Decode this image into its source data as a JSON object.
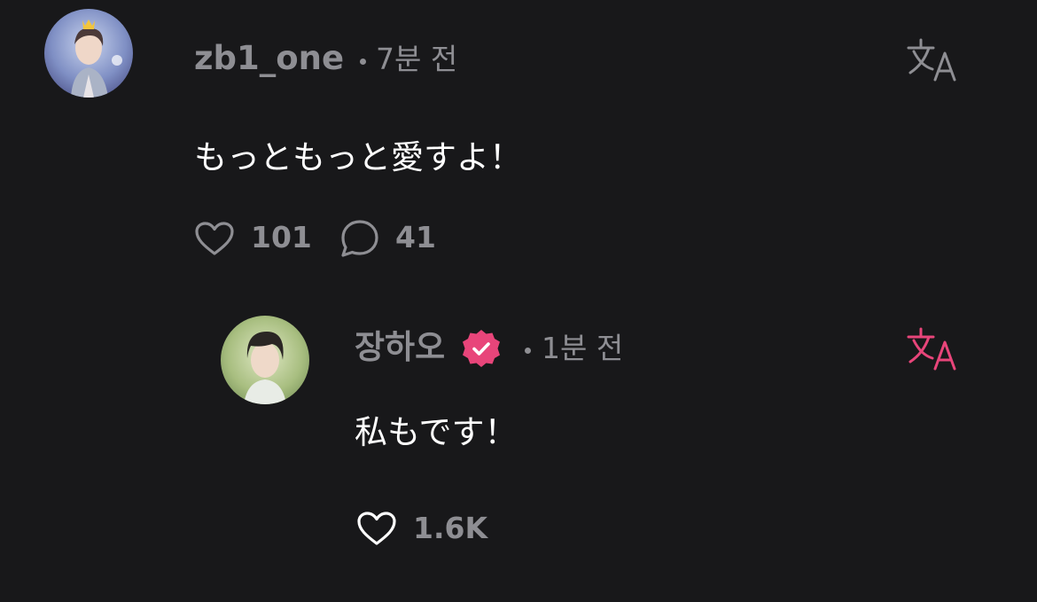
{
  "comments": [
    {
      "username": "zb1_one",
      "time": "7분 전",
      "text": "もっともっと愛すよ！",
      "likes": "101",
      "replies": "41",
      "verified": false,
      "avatar_icon": "user-avatar-photo",
      "translate_icon": "translate-icon",
      "translate_color": "#8e8e93"
    },
    {
      "username": "장하오",
      "time": "1분 전",
      "text": "私もです！",
      "likes": "1.6K",
      "verified": true,
      "verified_color": "#e8457a",
      "avatar_icon": "user-avatar-photo",
      "translate_icon": "translate-icon",
      "translate_color": "#e8457a"
    }
  ]
}
